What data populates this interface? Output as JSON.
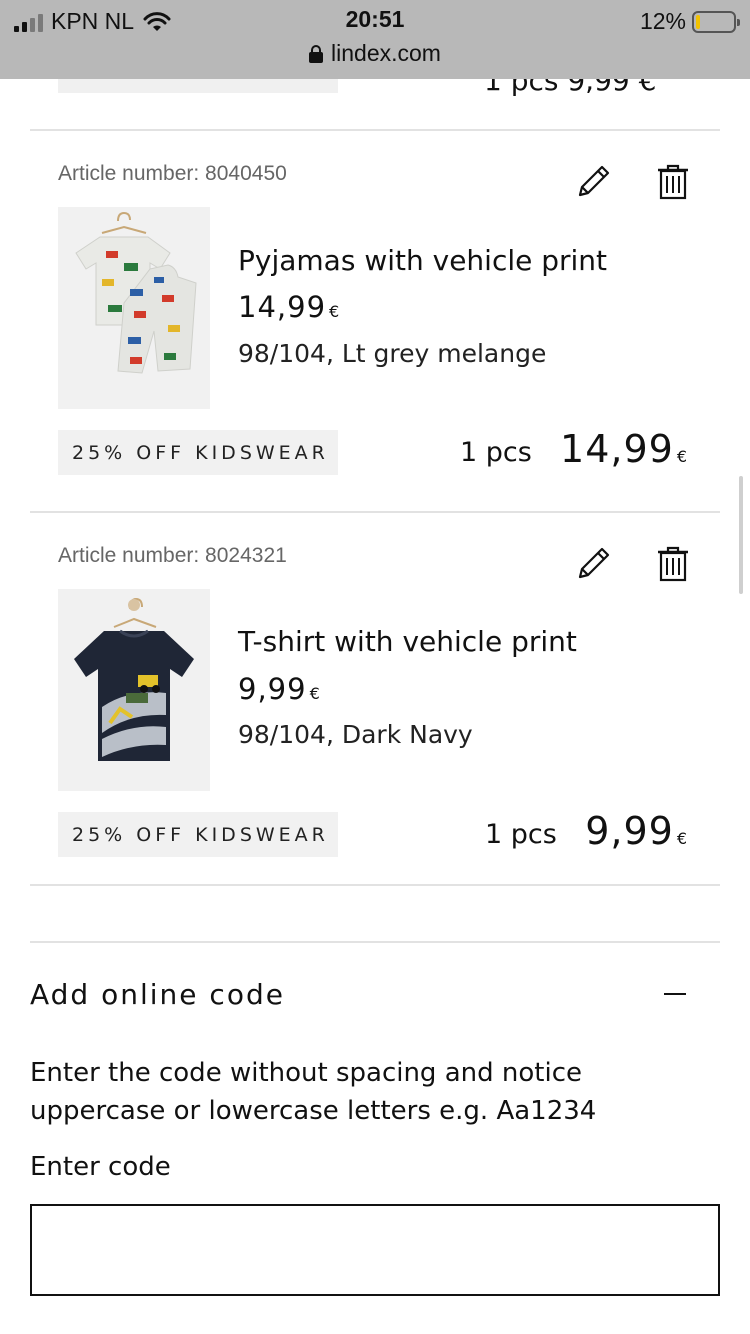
{
  "status_bar": {
    "carrier": "KPN NL",
    "time": "20:51",
    "battery_percent_label": "12%",
    "battery_level": 0.12,
    "url": "lindex.com",
    "icons": [
      "signal-icon",
      "wifi-icon",
      "battery-icon",
      "lock-icon"
    ]
  },
  "previous_item": {
    "qty_fragment": "1 pcs   9,99 €"
  },
  "items": [
    {
      "article": "Article number: 8040450",
      "name": "Pyjamas with vehicle print",
      "price": "14,99",
      "currency": "€",
      "variant": "98/104, Lt grey melange",
      "promo": "25% OFF KIDSWEAR",
      "qty": "1 pcs",
      "total": "14,99",
      "total_currency": "€"
    },
    {
      "article": "Article number: 8024321",
      "name": "T-shirt with vehicle print",
      "price": "9,99",
      "currency": "€",
      "variant": "98/104, Dark Navy",
      "promo": "25% OFF KIDSWEAR",
      "qty": "1 pcs",
      "total": "9,99",
      "total_currency": "€"
    }
  ],
  "online_code": {
    "title": "Add online code",
    "help": "Enter the code without spacing and notice uppercase or lowercase letters e.g. Aa1234",
    "label": "Enter code",
    "value": "",
    "toggle_symbol": "–"
  },
  "colors": {
    "status_bar_bg": "#b8b8b8",
    "promo_bg": "#f1f1f1",
    "divider": "#e2e2e2",
    "battery_fill": "#f2c200",
    "tshirt": "#1f2636"
  }
}
